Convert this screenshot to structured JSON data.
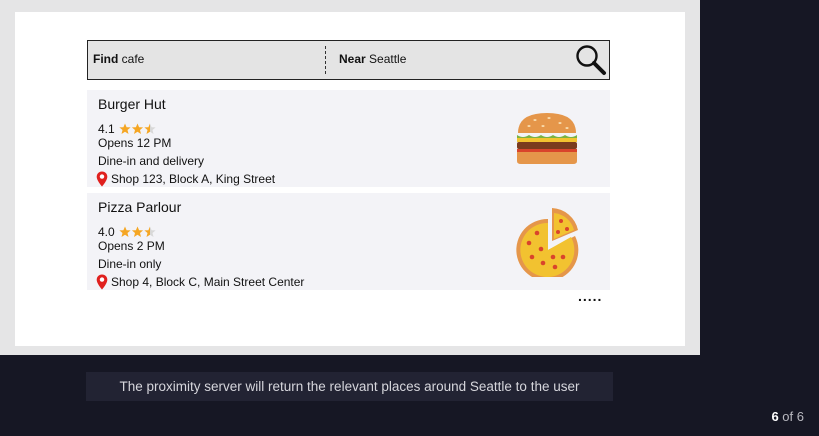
{
  "search": {
    "find_label": "Find",
    "find_value": "cafe",
    "near_label": "Near",
    "near_value": "Seattle"
  },
  "results": [
    {
      "name": "Burger Hut",
      "rating": "4.1",
      "hours": "Opens 12 PM",
      "service": "Dine-in and delivery",
      "address": "Shop 123, Block A, King Street",
      "image": "burger-icon"
    },
    {
      "name": "Pizza Parlour",
      "rating": "4.0",
      "hours": "Opens 2 PM",
      "service": "Dine-in only",
      "address": "Shop 4, Block C, Main Street Center",
      "image": "pizza-icon"
    }
  ],
  "more": ".....",
  "caption": "The proximity server will return the relevant places around Seattle to the user",
  "pager": {
    "current": "6",
    "separator": "of",
    "total": "6"
  },
  "colors": {
    "star": "#f5a623",
    "pin": "#e0201e",
    "background": "#161724"
  }
}
